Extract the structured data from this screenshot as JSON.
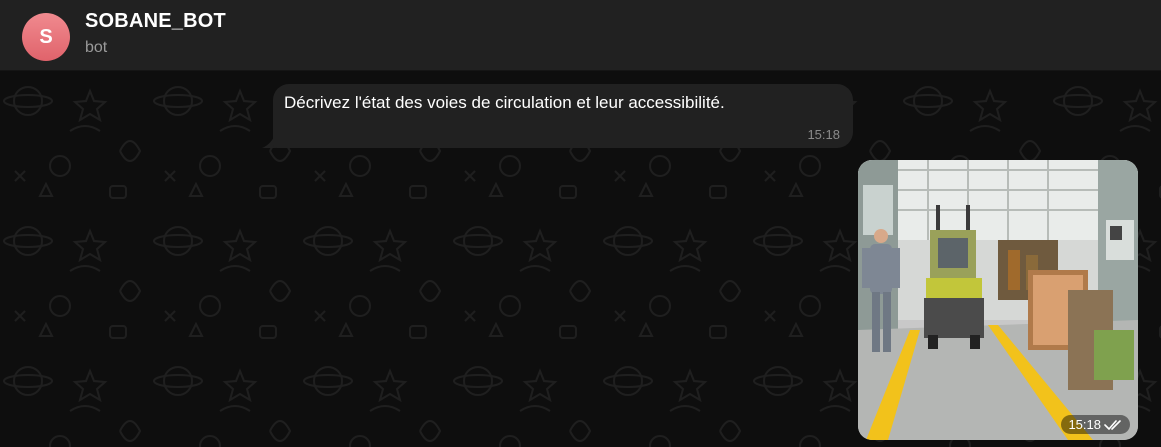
{
  "chat": {
    "avatar_letter": "S",
    "title": "SOBANE_BOT",
    "subtitle": "bot"
  },
  "messages": [
    {
      "direction": "incoming",
      "text": "Décrivez l'état des voies de circulation et leur accessibilité.",
      "time": "15:18"
    },
    {
      "direction": "outgoing",
      "type": "photo",
      "time": "15:18",
      "status_icon": "double-check-icon"
    }
  ],
  "colors": {
    "background": "#0e0e0e",
    "header": "#212121",
    "bubble": "#212121",
    "avatar": "#e8727a"
  }
}
